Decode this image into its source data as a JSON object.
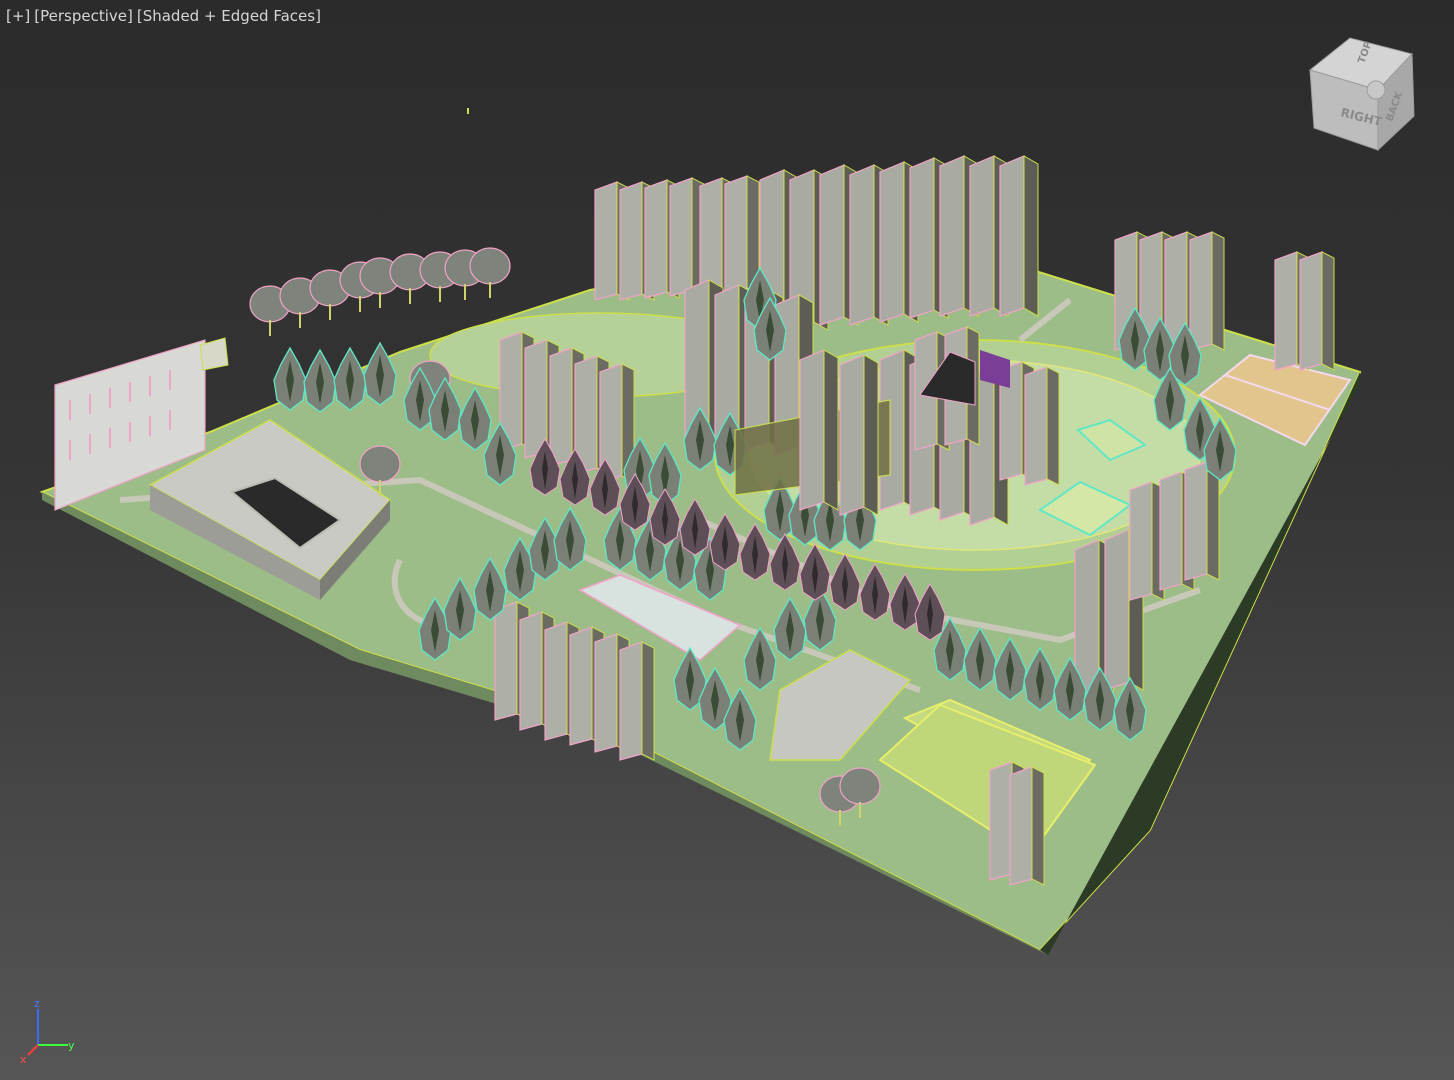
{
  "viewport": {
    "label_plus": "[+]",
    "label_view": "[Perspective]",
    "label_shading": "[Shaded + Edged Faces]"
  },
  "viewcube": {
    "face_right": "RIGHT",
    "face_top": "TOP",
    "face_back": "BACK",
    "icon": "viewcube-icon"
  },
  "axis_gizmo": {
    "z": "z",
    "y": "y",
    "x": "x"
  },
  "colors": {
    "ground": "#9fbf8a",
    "lawn": "#b8d49b",
    "edge_yellow": "#cddf4a",
    "edge_pink": "#f0a3c8",
    "edge_cyan": "#5fe7c6",
    "tree": "#7a7f76",
    "building": "#a8aaa3",
    "building_dark": "#5a5a52",
    "court": "#e2c58c"
  }
}
